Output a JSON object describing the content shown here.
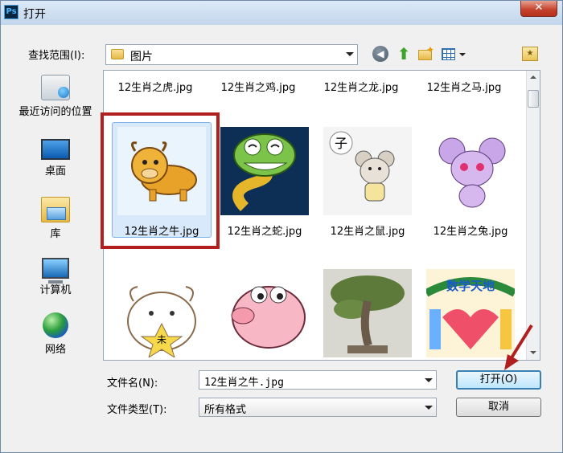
{
  "window": {
    "title": "打开",
    "app_icon": "Ps",
    "close_glyph": "✕"
  },
  "toolbar": {
    "look_in_label": "查找范围(I):",
    "location": "图片",
    "icons": [
      "back-icon",
      "up-folder-icon",
      "new-folder-icon",
      "view-menu-icon",
      "favorites-icon"
    ]
  },
  "places": [
    {
      "label": "最近访问的位置",
      "icon": "recent-places-icon"
    },
    {
      "label": "桌面",
      "icon": "desktop-icon"
    },
    {
      "label": "库",
      "icon": "library-icon"
    },
    {
      "label": "计算机",
      "icon": "computer-icon"
    },
    {
      "label": "网络",
      "icon": "network-icon"
    }
  ],
  "files": {
    "row0": [
      "12生肖之虎.jpg",
      "12生肖之鸡.jpg",
      "12生肖之龙.jpg",
      "12生肖之马.jpg"
    ],
    "row1": [
      "12生肖之牛.jpg",
      "12生肖之蛇.jpg",
      "12生肖之鼠.jpg",
      "12生肖之兔.jpg"
    ],
    "row2": [
      "",
      "",
      "",
      ""
    ],
    "selected": "12生肖之牛.jpg",
    "thumb_text": {
      "rat_char": "子",
      "sheep_char": "未",
      "poster_title": "数学天地"
    }
  },
  "footer": {
    "filename_label": "文件名(N):",
    "filename_value": "12生肖之牛.jpg",
    "filetype_label": "文件类型(T):",
    "filetype_value": "所有格式",
    "open_button": "打开(O)",
    "cancel_button": "取消"
  },
  "colors": {
    "highlight": "#b21f1f",
    "selection": "#d7e9fb",
    "accent_blue": "#3c7fb1"
  }
}
